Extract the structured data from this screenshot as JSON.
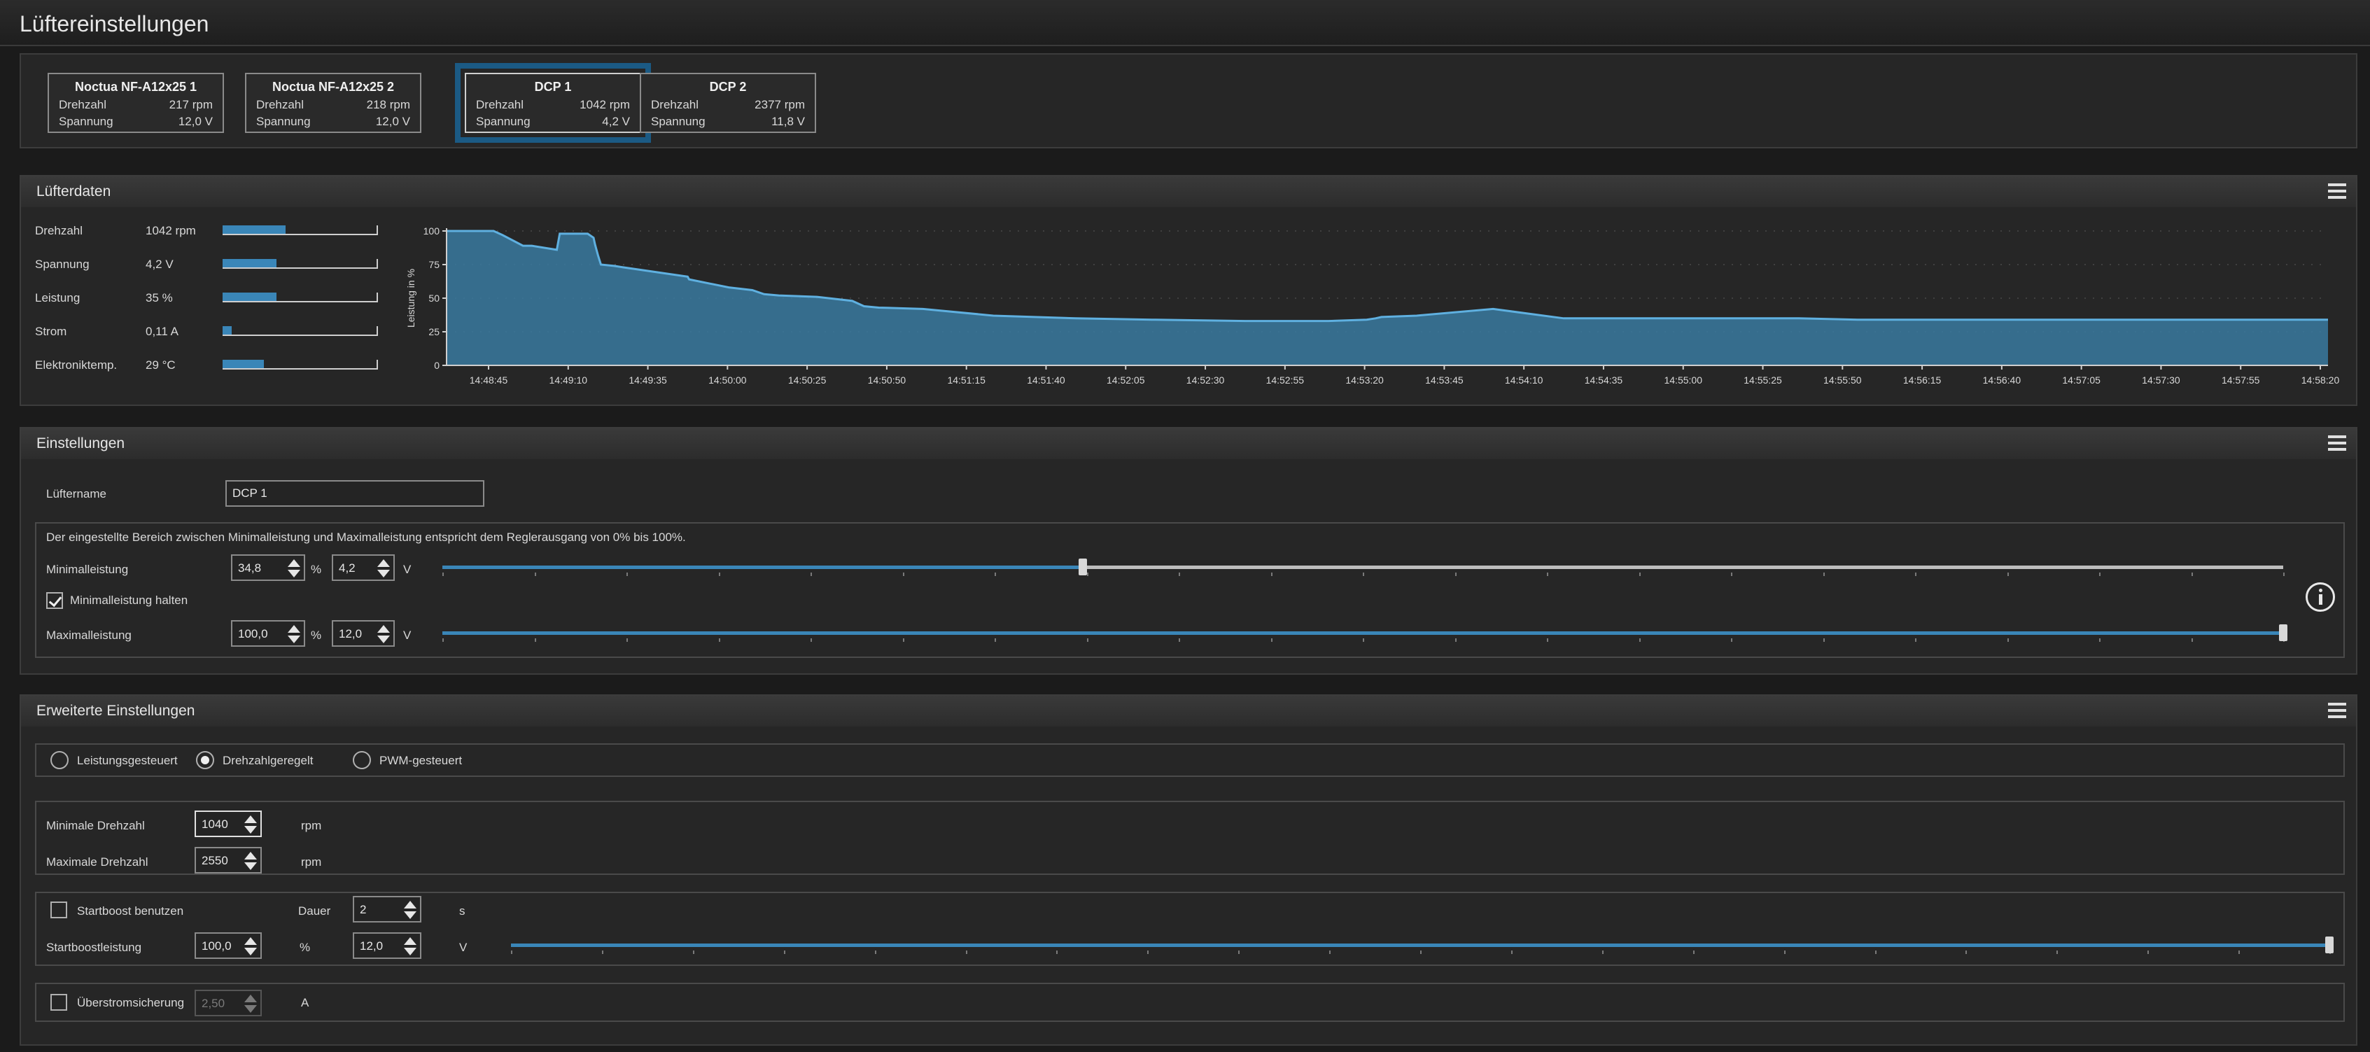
{
  "window": {
    "title": "Lüftereinstellungen"
  },
  "fans": [
    {
      "name": "Noctua NF-A12x25 1",
      "rpm_label": "Drehzahl",
      "rpm": "217 rpm",
      "volt_label": "Spannung",
      "volt": "12,0 V",
      "selected": false
    },
    {
      "name": "Noctua NF-A12x25 2",
      "rpm_label": "Drehzahl",
      "rpm": "218 rpm",
      "volt_label": "Spannung",
      "volt": "12,0 V",
      "selected": false
    },
    {
      "name": "DCP 1",
      "rpm_label": "Drehzahl",
      "rpm": "1042 rpm",
      "volt_label": "Spannung",
      "volt": "4,2 V",
      "selected": true
    },
    {
      "name": "DCP 2",
      "rpm_label": "Drehzahl",
      "rpm": "2377 rpm",
      "volt_label": "Spannung",
      "volt": "11,8 V",
      "selected": false
    }
  ],
  "fan_data": {
    "title": "Lüfterdaten",
    "rows": [
      {
        "label": "Drehzahl",
        "value": "1042 rpm",
        "level": 0.41
      },
      {
        "label": "Spannung",
        "value": "4,2 V",
        "level": 0.35
      },
      {
        "label": "Leistung",
        "value": "35 %",
        "level": 0.35
      },
      {
        "label": "Strom",
        "value": "0,11 A",
        "level": 0.06
      },
      {
        "label": "Elektroniktemp.",
        "value": "29 °C",
        "level": 0.27
      }
    ]
  },
  "chart_data": {
    "type": "area",
    "ylabel": "Leistung in %",
    "xlabel": "",
    "ylim": [
      0,
      100
    ],
    "yticks": [
      "0",
      "25",
      "50",
      "75",
      "100"
    ],
    "xticks": [
      "14:48:45",
      "14:49:10",
      "14:49:35",
      "14:50:00",
      "14:50:25",
      "14:50:50",
      "14:51:15",
      "14:51:40",
      "14:52:05",
      "14:52:30",
      "14:52:55",
      "14:53:20",
      "14:53:45",
      "14:54:10",
      "14:54:35",
      "14:55:00",
      "14:55:25",
      "14:55:50",
      "14:56:15",
      "14:56:40",
      "14:57:05",
      "14:57:30",
      "14:57:55",
      "14:58:20"
    ],
    "grid": true,
    "color": "#3a7aa0",
    "line_color": "#5fb0e0",
    "x": [
      0,
      12.5,
      16,
      19,
      26,
      29,
      37.5,
      38.5,
      48,
      50,
      50.5,
      51.5,
      52.5,
      57,
      60,
      82,
      82.5,
      96,
      104,
      108,
      113,
      126,
      138,
      142,
      147,
      162,
      186,
      214,
      240,
      272,
      300,
      313,
      316,
      318,
      330,
      356,
      380,
      400,
      420,
      440,
      460,
      480,
      510,
      530,
      580,
      640
    ],
    "y": [
      100,
      100,
      100,
      97,
      89,
      89,
      86,
      98,
      98,
      95,
      90,
      82,
      75,
      74,
      73,
      66,
      64,
      58,
      56,
      53,
      52,
      51,
      48,
      44,
      43,
      42,
      37,
      35,
      34,
      33,
      33,
      34,
      35,
      36,
      37,
      42,
      35,
      35,
      35,
      35,
      35,
      34,
      34,
      34,
      34,
      34
    ]
  },
  "settings": {
    "title": "Einstellungen",
    "fan_name_label": "Lüftername",
    "fan_name_value": "DCP 1",
    "range_note": "Der eingestellte Bereich zwischen Minimalleistung und Maximalleistung entspricht dem Reglerausgang von 0% bis 100%.",
    "min_label": "Minimalleistung",
    "min_percent": "34,8",
    "min_volt": "4,2",
    "percent_unit": "%",
    "volt_unit": "V",
    "min_slider_level": 0.348,
    "hold_min_label": "Minimalleistung halten",
    "hold_min_checked": true,
    "max_label": "Maximalleistung",
    "max_percent": "100,0",
    "max_volt": "12,0",
    "max_slider_level": 1.0
  },
  "advanced": {
    "title": "Erweiterte Einstellungen",
    "modes": [
      {
        "label": "Leistungsgesteuert",
        "selected": false
      },
      {
        "label": "Drehzahlgeregelt",
        "selected": true
      },
      {
        "label": "PWM-gesteuert",
        "selected": false
      }
    ],
    "min_rpm_label": "Minimale Drehzahl",
    "min_rpm_value": "1040",
    "max_rpm_label": "Maximale Drehzahl",
    "max_rpm_value": "2550",
    "rpm_unit": "rpm",
    "startboost_label": "Startboost benutzen",
    "startboost_checked": false,
    "duration_label": "Dauer",
    "duration_value": "2",
    "duration_unit": "s",
    "startboost_power_label": "Startboostleistung",
    "startboost_percent": "100,0",
    "percent_unit": "%",
    "startboost_volt": "12,0",
    "volt_unit": "V",
    "startboost_slider_level": 1.0,
    "overcurrent_label": "Überstromsicherung",
    "overcurrent_checked": false,
    "overcurrent_value": "2,50",
    "overcurrent_unit": "A"
  }
}
